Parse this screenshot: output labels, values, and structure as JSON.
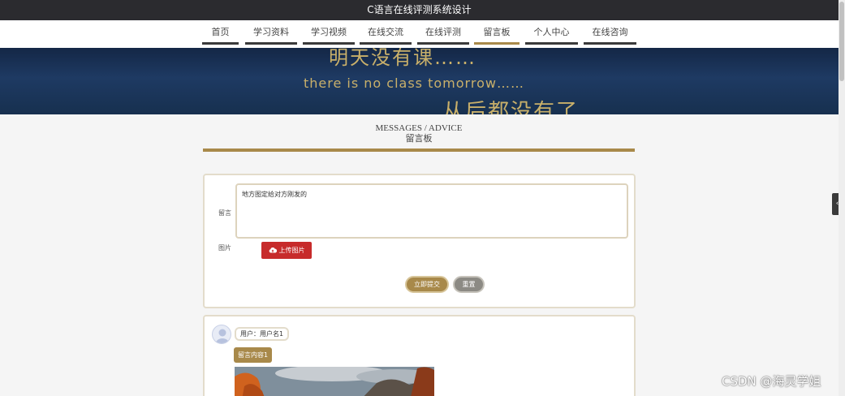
{
  "header": {
    "title": "C语言在线评测系统设计"
  },
  "nav": {
    "items": [
      {
        "label": "首页"
      },
      {
        "label": "学习资料"
      },
      {
        "label": "学习视频"
      },
      {
        "label": "在线交流"
      },
      {
        "label": "在线评测"
      },
      {
        "label": "留言板"
      },
      {
        "label": "个人中心"
      },
      {
        "label": "在线咨询"
      }
    ],
    "active_index": 5
  },
  "banner": {
    "line1": "明天没有课……",
    "line2": "there is no class tomorrow……",
    "line3": "从后都没有了……"
  },
  "section": {
    "title_en": "MESSAGES / ADVICE",
    "title_cn": "留言板"
  },
  "form": {
    "message_label": "留言",
    "message_value": "地方图定给对方刚发的",
    "image_label": "图片",
    "upload_label": "上传图片",
    "submit_label": "立即提交",
    "reset_label": "重置"
  },
  "message": {
    "user_text": "用户：用户名1",
    "content_text": "留言内容1"
  },
  "side_tab": {
    "label": "‹"
  },
  "watermark": {
    "text": "CSDN @海灵学姐"
  },
  "colors": {
    "accent": "#a8894a",
    "upload": "#c72b2b",
    "topbar": "#2b2b2f",
    "banner": "#1e3a63"
  }
}
